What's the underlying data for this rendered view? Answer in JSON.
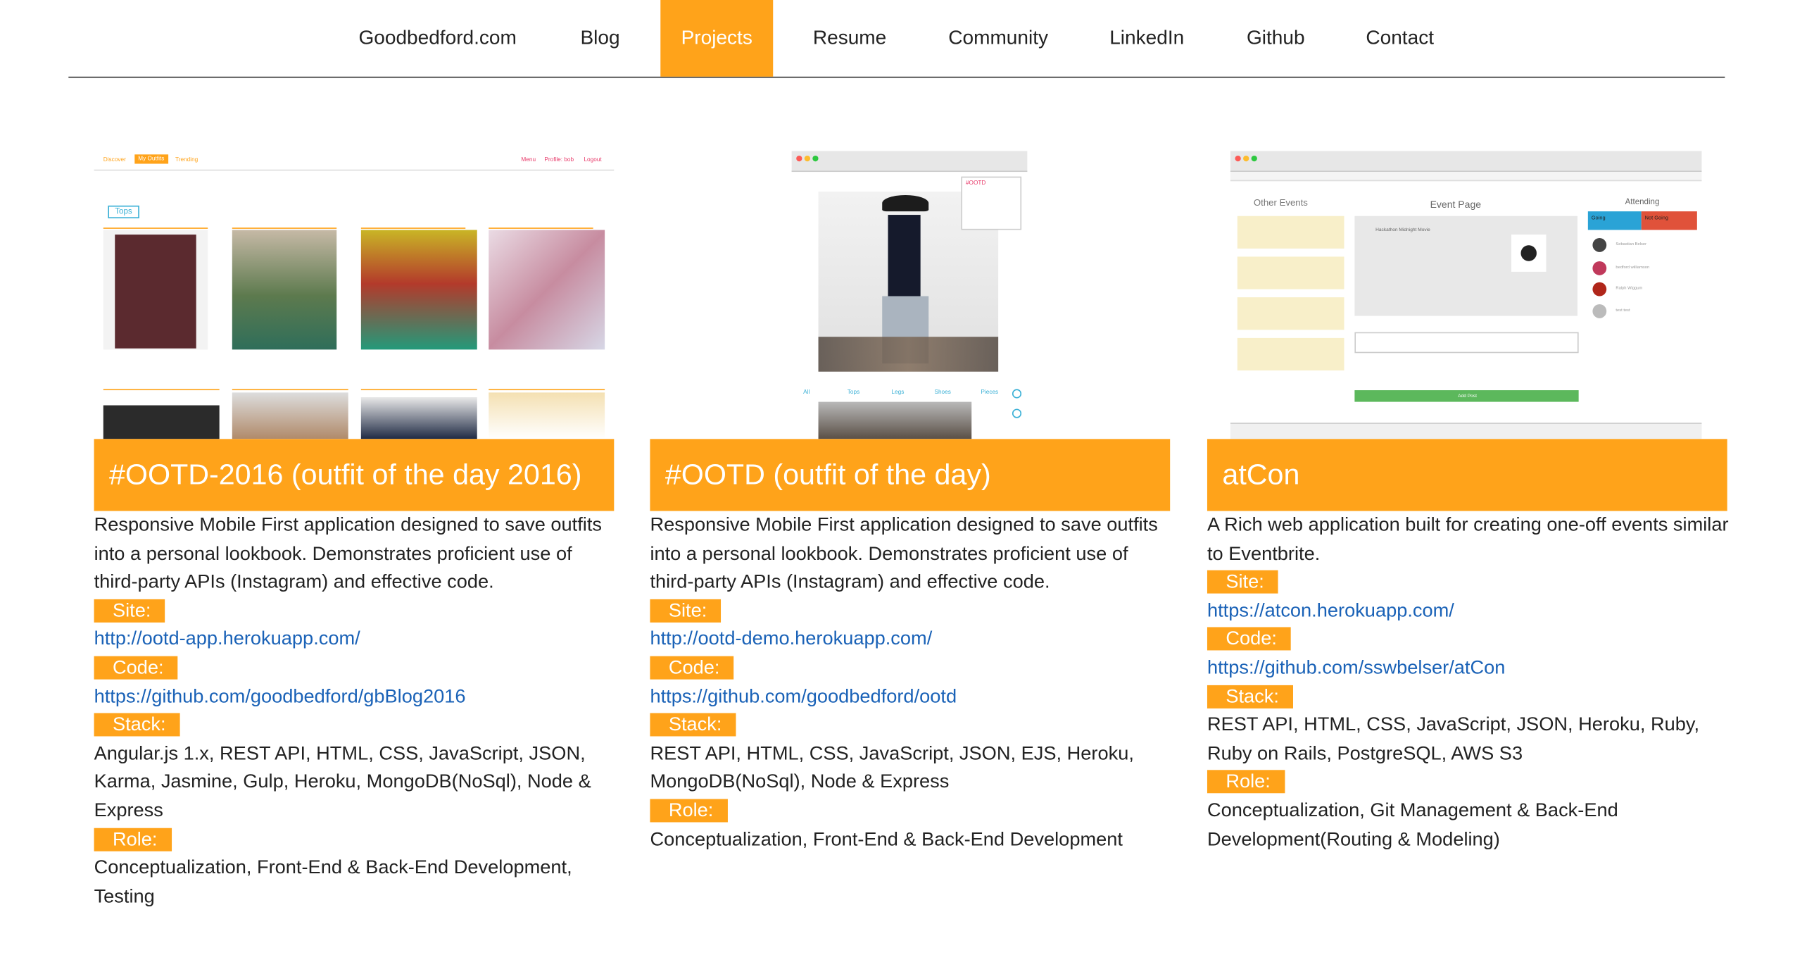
{
  "nav": {
    "items": [
      {
        "label": "Goodbedford.com",
        "active": false
      },
      {
        "label": "Blog",
        "active": false
      },
      {
        "label": "Projects",
        "active": true
      },
      {
        "label": "Resume",
        "active": false
      },
      {
        "label": "Community",
        "active": false
      },
      {
        "label": "LinkedIn",
        "active": false
      },
      {
        "label": "Github",
        "active": false
      },
      {
        "label": "Contact",
        "active": false
      }
    ]
  },
  "accent": "#ffa31a",
  "link_color": "#1a62b7",
  "projects": [
    {
      "title": "#OOTD-2016 (outfit of the day 2016)",
      "description": "Responsive Mobile First application designed to save outfits into a personal lookbook. Demonstrates proficient use of third-party APIs (Instagram) and effective code.",
      "site_label": "Site:",
      "site_url": "http://ootd-app.herokuapp.com/",
      "code_label": "Code:",
      "code_url": "https://github.com/goodbedford/gbBlog2016",
      "stack_label": "Stack:",
      "stack": "Angular.js 1.x, REST API, HTML, CSS, JavaScript, JSON, Karma, Jasmine, Gulp, Heroku, MongoDB(NoSql), Node & Express",
      "role_label": "Role:",
      "role": "Conceptualization, Front-End & Back-End Development, Testing",
      "shot": {
        "nav_left": [
          "Discover",
          "My Outfits",
          "Trending"
        ],
        "nav_right": [
          "Menu",
          "Profile: bob",
          "Logout"
        ],
        "filter_tag": "Tops"
      }
    },
    {
      "title": "#OOTD (outfit of the day)",
      "description": "Responsive Mobile First application designed to save outfits into a personal lookbook. Demonstrates proficient use of third-party APIs (Instagram) and effective code.",
      "site_label": "Site:",
      "site_url": "http://ootd-demo.herokuapp.com/",
      "code_label": "Code:",
      "code_url": "https://github.com/goodbedford/ootd",
      "stack_label": "Stack:",
      "stack": "REST API, HTML, CSS, JavaScript, JSON, EJS, Heroku, MongoDB(NoSql), Node & Express",
      "role_label": "Role:",
      "role": "Conceptualization, Front-End & Back-End Development",
      "shot": {
        "filters": [
          "All",
          "Tops",
          "Legs",
          "Shoes",
          "Pieces"
        ],
        "side_tag": "#OOTD"
      }
    },
    {
      "title": "atCon",
      "description": "A Rich web application built for creating one-off events similar to Eventbrite.",
      "site_label": "Site:",
      "site_url": "https://atcon.herokuapp.com/",
      "code_label": "Code:",
      "code_url": "https://github.com/sswbelser/atCon",
      "stack_label": "Stack:",
      "stack": "REST API, HTML, CSS, JavaScript, JSON, Heroku, Ruby, Ruby on Rails, PostgreSQL, AWS S3",
      "role_label": "Role:",
      "role": "Conceptualization, Git Management & Back-End Development(Routing & Modeling)",
      "shot": {
        "left_heading": "Other Events",
        "mid_heading": "Event Page",
        "right_heading": "Attending",
        "going": "Going",
        "not_going": "Not Going",
        "event_name": "Hackathon Midnight Movie",
        "attendees": [
          "Sebastian Belser",
          "bedford williamson",
          "Ralph Wiggum",
          "test test"
        ],
        "add_post": "Add Post"
      }
    }
  ]
}
